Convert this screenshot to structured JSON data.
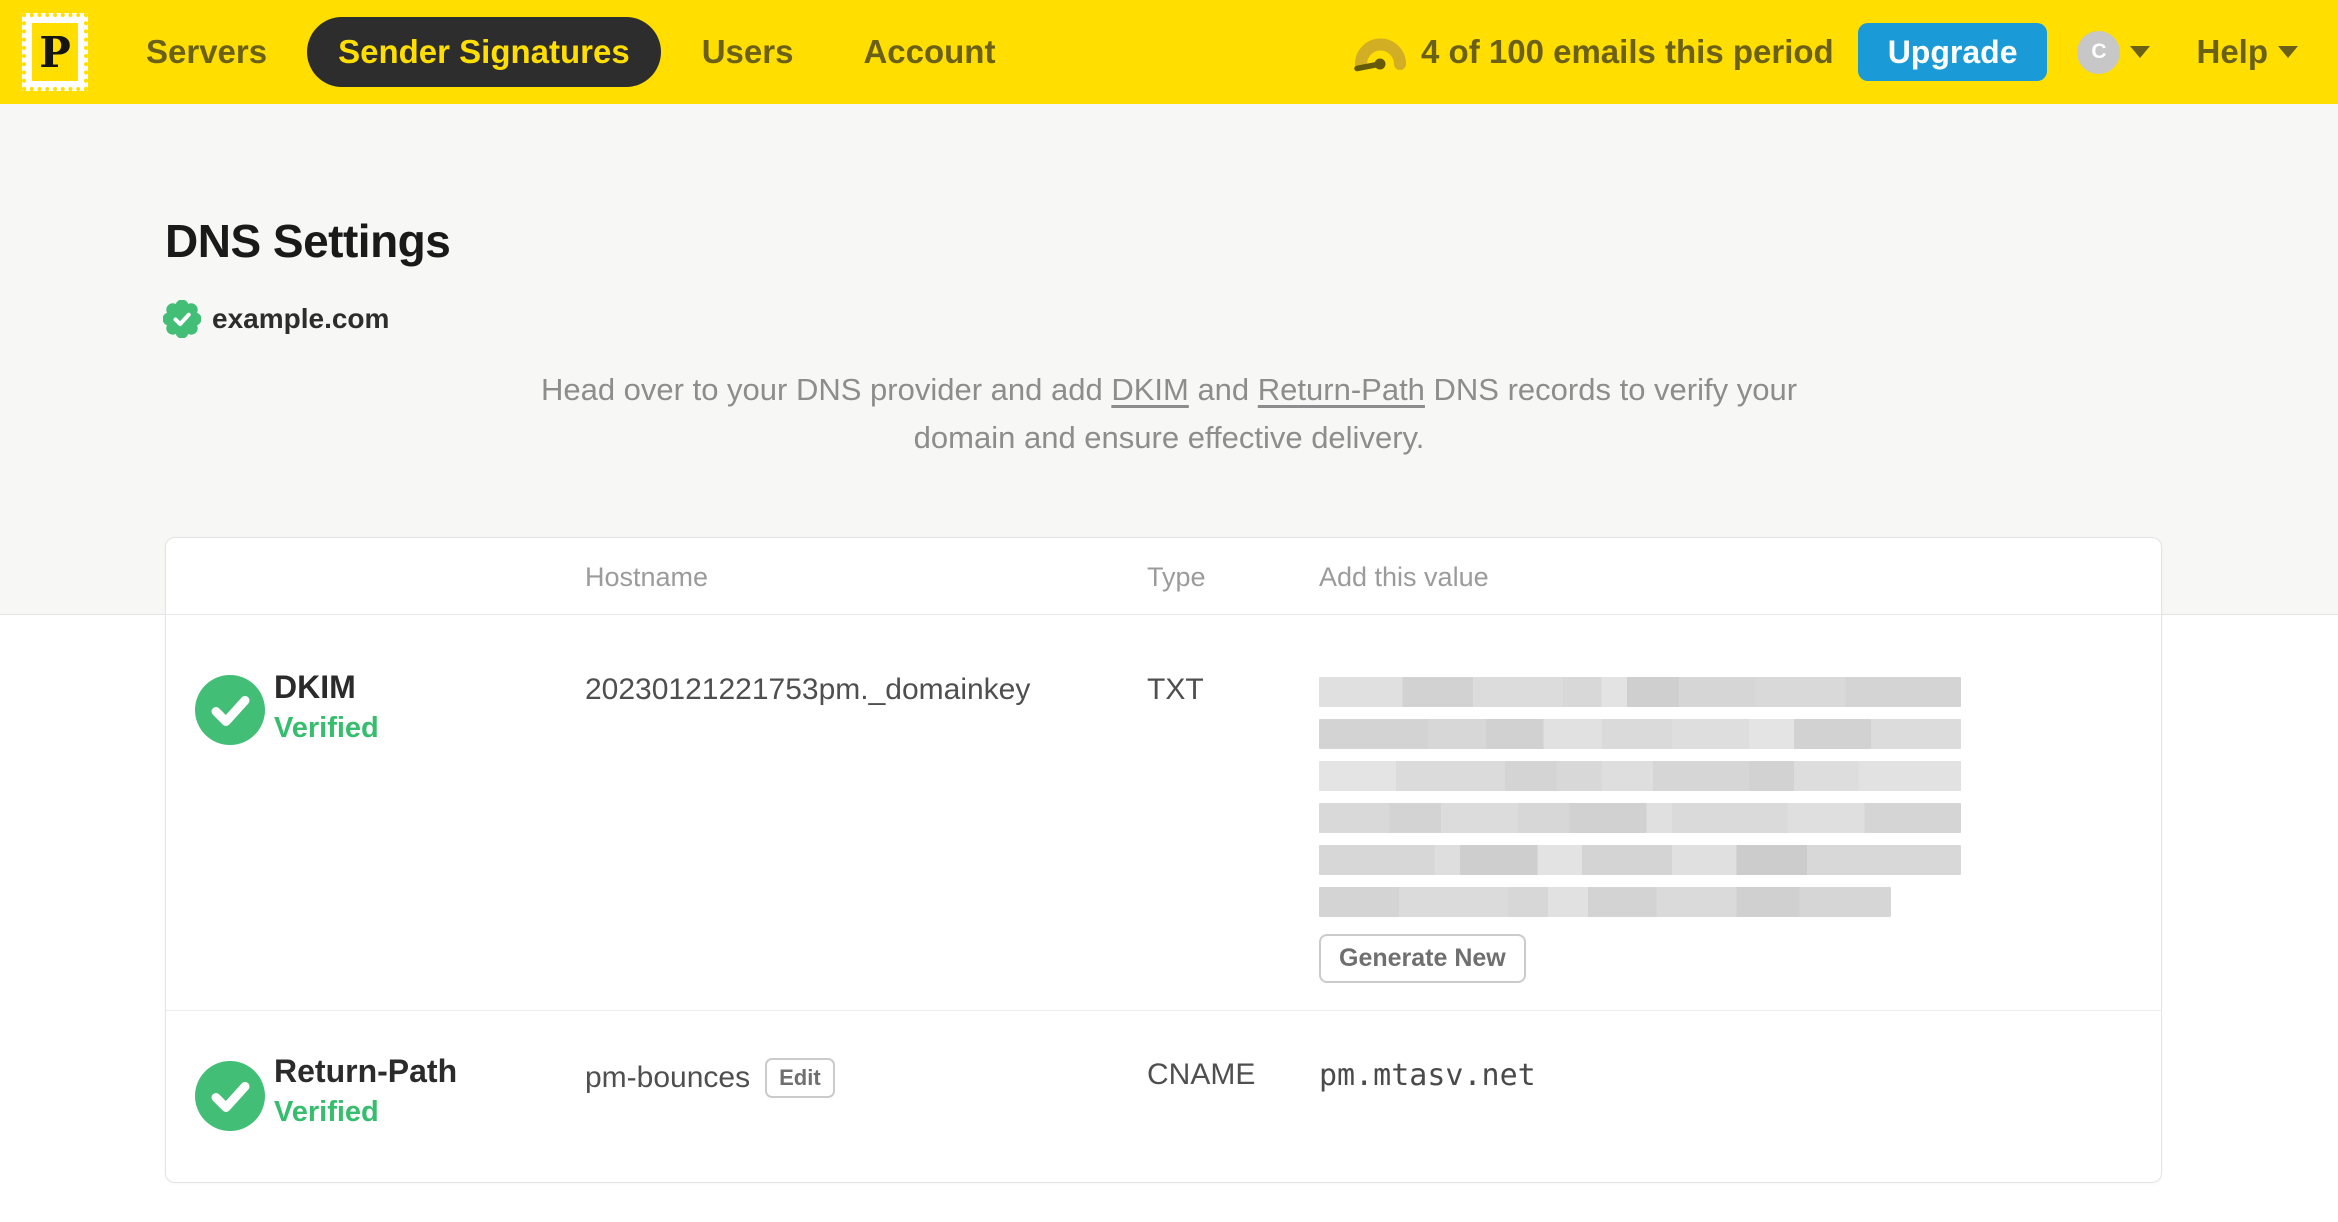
{
  "colors": {
    "brand_yellow": "#FFDE00",
    "pill_dark": "#2D2D2D",
    "upgrade_blue": "#1A9AD6",
    "success_green": "#42BE76",
    "status_green_text": "#36BD6D"
  },
  "nav": {
    "logo_letter": "P",
    "items": [
      {
        "label": "Servers",
        "active": false
      },
      {
        "label": "Sender Signatures",
        "active": true
      },
      {
        "label": "Users",
        "active": false
      },
      {
        "label": "Account",
        "active": false
      }
    ],
    "usage_text": "4 of 100 emails this period",
    "upgrade_label": "Upgrade",
    "avatar_initial": "C",
    "help_label": "Help"
  },
  "page": {
    "title": "DNS Settings",
    "domain": "example.com",
    "description": {
      "part1": "Head over to your DNS provider and add ",
      "link_dkim": "DKIM",
      "part2": " and ",
      "link_return_path": "Return-Path",
      "part3": " DNS records to verify your domain and ensure effective delivery."
    }
  },
  "table": {
    "headers": {
      "hostname": "Hostname",
      "type": "Type",
      "value": "Add this value"
    },
    "dkim_row": {
      "name": "DKIM",
      "status": "Verified",
      "hostname": "20230121221753pm._domainkey",
      "type": "TXT",
      "value_redacted": true,
      "action_label": "Generate New"
    },
    "return_path_row": {
      "name": "Return-Path",
      "status": "Verified",
      "hostname": "pm-bounces",
      "edit_label": "Edit",
      "type": "CNAME",
      "value": "pm.mtasv.net"
    }
  }
}
